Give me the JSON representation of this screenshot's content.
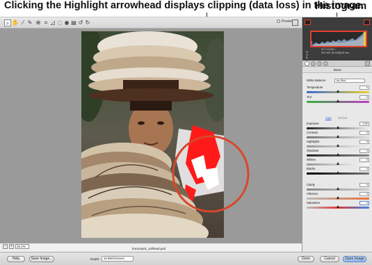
{
  "callouts": {
    "left": "Clicking the Highlight arrowhead displays clipping (data loss) in the image.",
    "right": "Histogram"
  },
  "toolbar": {
    "preview_label": "Preview",
    "tools": [
      "zoom-icon",
      "hand-icon",
      "white-balance-icon",
      "color-sampler-icon",
      "target-adjust-icon",
      "crop-icon",
      "straighten-icon",
      "spot-removal-icon",
      "red-eye-icon",
      "preferences-icon",
      "rotate-left-icon",
      "rotate-right-icon"
    ]
  },
  "canvas": {
    "filename": "boracay01_indhead.psd",
    "zoom": "25.4%"
  },
  "histogram": {
    "readout_left": [
      "R:",
      "G:",
      "B:"
    ],
    "readout_vals": "f/7.1   1/125 s",
    "readout_iso": "ISO 400   18-125@18 mm"
  },
  "panel": {
    "title": "Basic",
    "white_balance_label": "White Balance:",
    "white_balance_value": "As Shot",
    "auto_label": "Auto",
    "default_label": "Default",
    "sliders": [
      {
        "label": "Temperature",
        "value": "0"
      },
      {
        "label": "Tint",
        "value": "0"
      },
      {
        "label": "Exposure",
        "value": "0.00"
      },
      {
        "label": "Contrast",
        "value": "0"
      },
      {
        "label": "Highlights",
        "value": "0"
      },
      {
        "label": "Shadows",
        "value": "0"
      },
      {
        "label": "Whites",
        "value": "0"
      },
      {
        "label": "Blacks",
        "value": "0"
      },
      {
        "label": "Clarity",
        "value": "0"
      },
      {
        "label": "Vibrance",
        "value": "0"
      },
      {
        "label": "Saturation",
        "value": "0"
      }
    ]
  },
  "bottom": {
    "help_label": "Help",
    "save_label": "Save Image...",
    "depth_label": "Depth:",
    "depth_value": "16 Bits/Channel",
    "done_label": "Done",
    "cancel_label": "Cancel",
    "open_label": "Open Image"
  },
  "colors": {
    "callout_circle": "#d9472b",
    "clip_highlight": "#ff1a1a",
    "default_button": "#8db6ee"
  }
}
